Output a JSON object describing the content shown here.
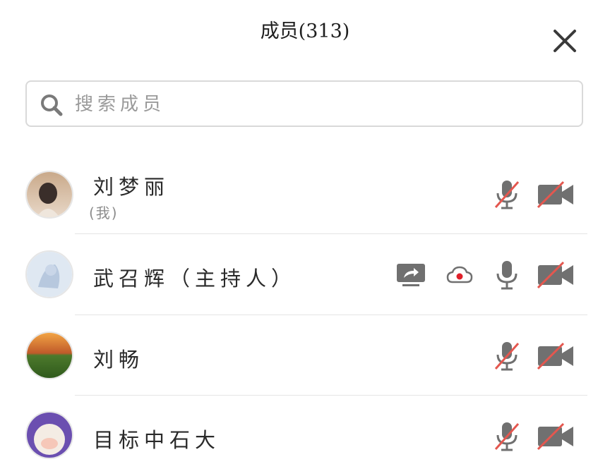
{
  "header": {
    "title": "成员(313)"
  },
  "search": {
    "placeholder": "搜索成员"
  },
  "members": [
    {
      "name": "刘梦丽",
      "tag": "(我)",
      "mic": "muted",
      "video": "off"
    },
    {
      "name": "武召辉（主持人）",
      "mic": "on",
      "video": "off",
      "sharing": true,
      "recording": true
    },
    {
      "name": "刘畅",
      "mic": "muted",
      "video": "off"
    },
    {
      "name": "目标中石大",
      "mic": "muted",
      "video": "off"
    }
  ],
  "colors": {
    "mute_slash": "#e4574f",
    "icon_gray": "#707070",
    "record_dot": "#e0202a"
  },
  "icons": [
    "close-icon",
    "search-icon",
    "mic-muted-icon",
    "mic-icon",
    "video-off-icon",
    "screen-share-icon",
    "cloud-record-icon"
  ]
}
